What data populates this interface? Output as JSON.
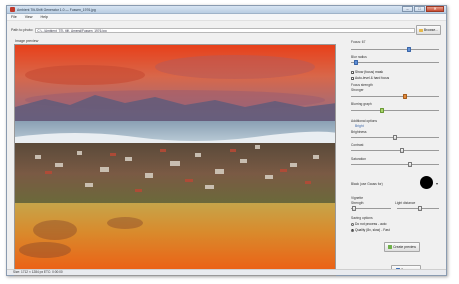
{
  "window": {
    "title": "Ambient Tilt-Shift Generator 1.0 — Fussen_1976.jpg",
    "controls": {
      "minimize": "–",
      "maximize": "□",
      "close": "✕"
    }
  },
  "menu": [
    "File",
    "View",
    "Help"
  ],
  "path_row": {
    "label": "Path to photo:",
    "value": "C:\\...\\Ambient_TS\\_tilt\\_Amend\\Fussen_1976.jpg",
    "browse_label": "Browse..."
  },
  "preview": {
    "label": "Image preview"
  },
  "side": {
    "focus_label": "Focus: 67",
    "focus_value": 0.67,
    "blur_label": "Blur radius",
    "blur_value": 0.03,
    "show_focus_mask": "Show (focus) mask",
    "show_focus_mask_checked": true,
    "auto_level": "Auto-level & hard focus",
    "auto_level_checked": true,
    "focus_strength_label": "Focus strength",
    "focus_strength_value": "Stronger",
    "focus_strength_level": 0.62,
    "blur_graph_label": "Blurring graph",
    "blur_graph_level": 0.34,
    "additional_label": "Additional options",
    "additional_sub": "Bright",
    "brightness_label": "Brightness",
    "brightness_level": 0.5,
    "contrast_label": "Contrast",
    "contrast_level": 0.58,
    "saturation_label": "Saturation",
    "saturation_level": 0.68,
    "color_label": "Black (use Gauss for)",
    "color_value": "#000000",
    "vignette_label": "Vignette",
    "vignette_left": "Strength",
    "vignette_right": "Light distance",
    "vignette_level": 0.02,
    "vignette_right_level": 0.56,
    "sharp_label": "Saving options",
    "radio1": "Do not process - auto",
    "radio1_checked": false,
    "radio2": "Quality (8x, slow) - Fast",
    "radio2_checked": true,
    "create_btn": "Create preview",
    "save_btn": "Save as..."
  },
  "status": "Size: 1712 × 1284 px   ETC: 0:00:00"
}
